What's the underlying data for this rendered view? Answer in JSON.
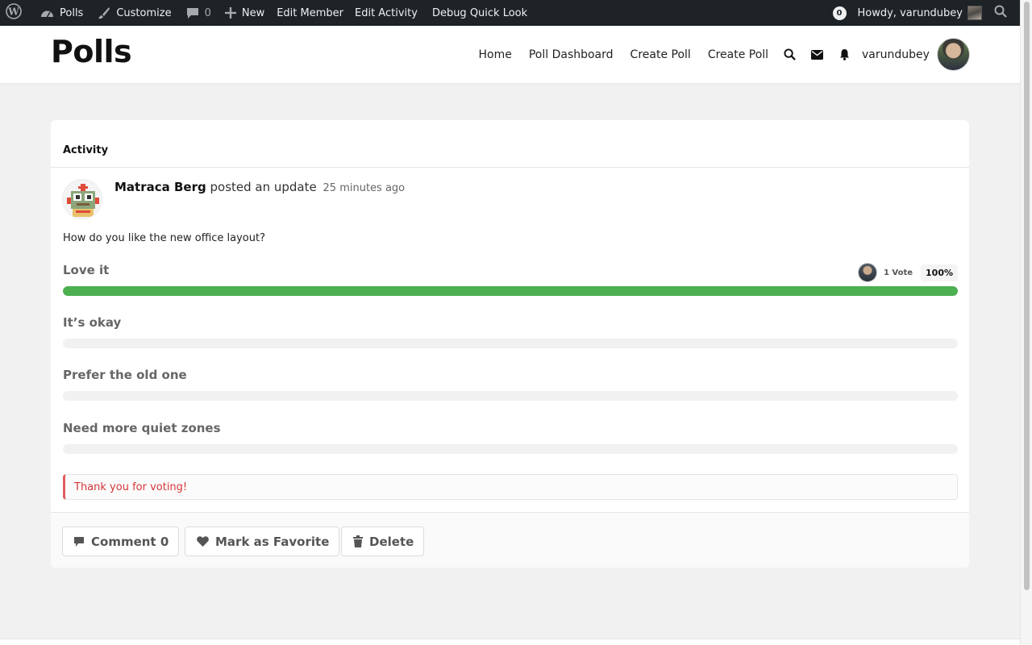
{
  "adminbar": {
    "site_name": "Polls",
    "customize": "Customize",
    "comments_count": "0",
    "new": "New",
    "edit_member": "Edit Member",
    "edit_activity": "Edit Activity",
    "debug": "Debug Quick Look",
    "notif_count": "0",
    "howdy": "Howdy, varundubey"
  },
  "header": {
    "site_title": "Polls",
    "nav": [
      "Home",
      "Poll Dashboard",
      "Create Poll",
      "Create Poll"
    ],
    "username": "varundubey"
  },
  "card": {
    "title": "Activity",
    "author": "Matraca Berg",
    "action": "posted an update",
    "time": "25 minutes ago",
    "question": "How do you like the new office layout?",
    "options": [
      {
        "label": "Love it",
        "percent": 100,
        "votes": "1 Vote",
        "percent_label": "100%"
      },
      {
        "label": "It’s okay",
        "percent": 0
      },
      {
        "label": "Prefer the old one",
        "percent": 0
      },
      {
        "label": "Need more quiet zones",
        "percent": 0
      }
    ],
    "notice": "Thank you for voting!",
    "actions": {
      "comment": "Comment 0",
      "favorite": "Mark as Favorite",
      "delete": "Delete"
    }
  },
  "colors": {
    "adminbar_bg": "#1d2327",
    "vote_bar": "#4caf50",
    "notice_text": "#d63638"
  }
}
